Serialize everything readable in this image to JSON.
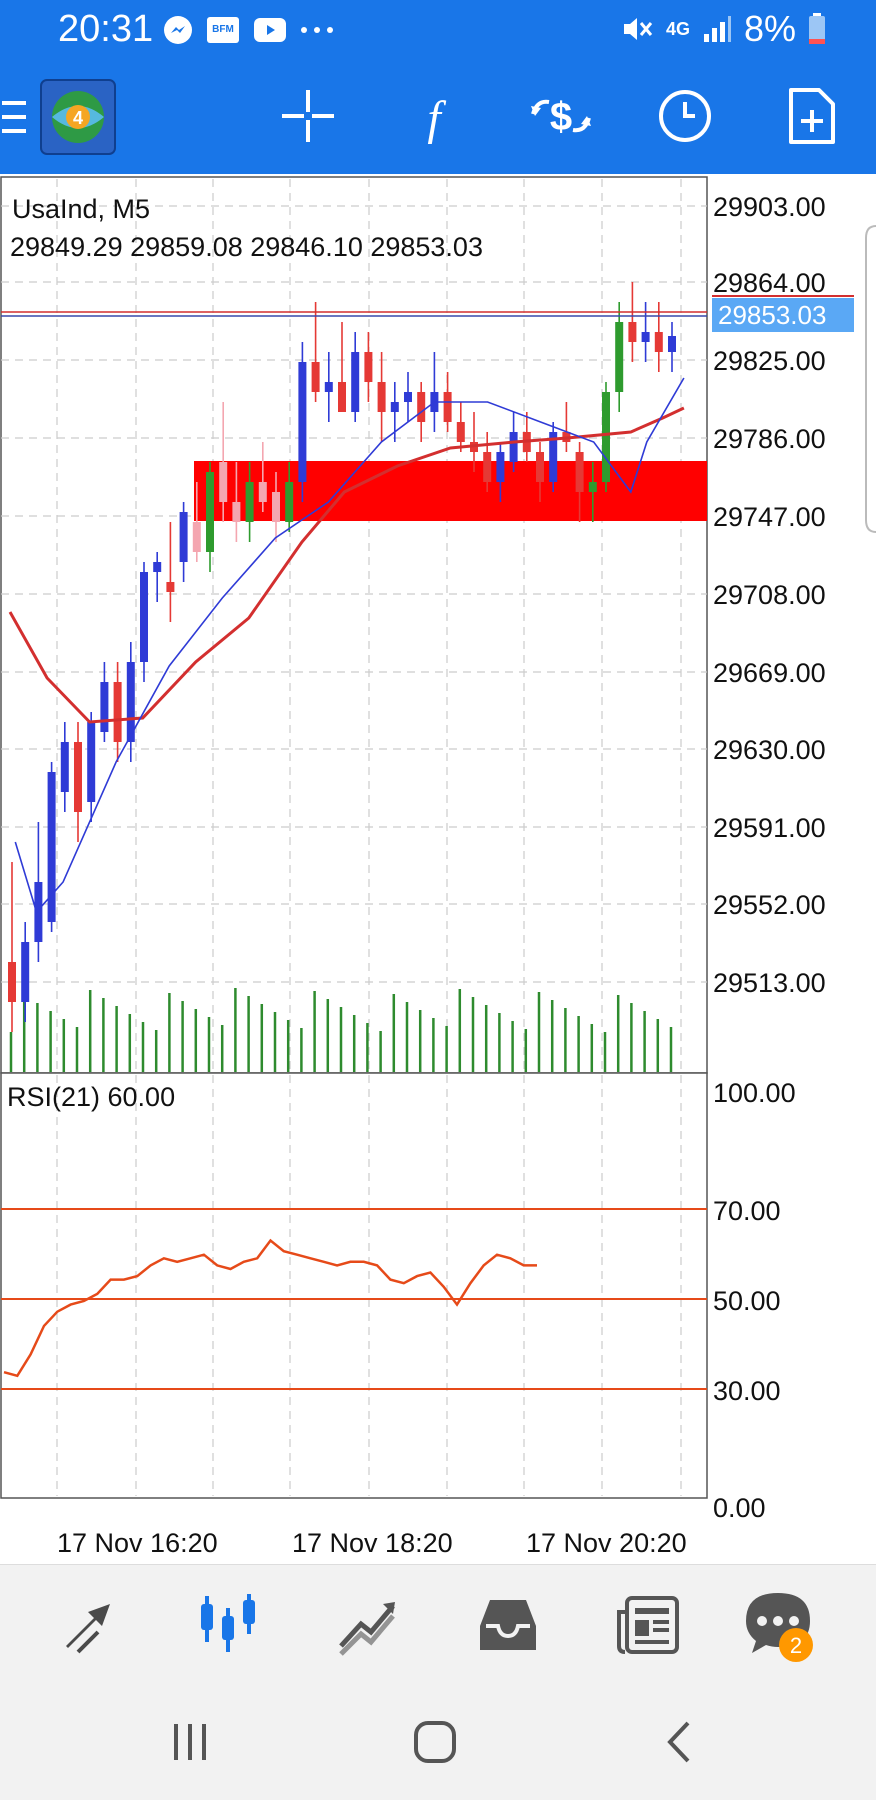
{
  "status_bar": {
    "time": "20:31",
    "network": "4G",
    "battery": "8%",
    "icons": [
      "messenger-icon",
      "bfm-business-icon",
      "youtube-icon",
      "more-dots-icon",
      "mute-icon",
      "signal-icon",
      "battery-icon"
    ]
  },
  "toolbar": {
    "buttons": [
      "crosshair",
      "indicators",
      "trade",
      "timeframe",
      "new-order"
    ]
  },
  "chart": {
    "symbol": "UsaInd, M5",
    "ohlc": "29849.29 29859.08 29846.10 29853.03",
    "current_price_tag": "29853.03",
    "price_labels": [
      "29903.00",
      "29864.00",
      "29825.00",
      "29786.00",
      "29747.00",
      "29708.00",
      "29669.00",
      "29630.00",
      "29591.00",
      "29552.00",
      "29513.00"
    ],
    "time_labels": [
      "17 Nov 16:20",
      "17 Nov 18:20",
      "17 Nov 20:20"
    ]
  },
  "rsi": {
    "title": "RSI(21) 60.00",
    "labels": [
      "100.00",
      "70.00",
      "50.00",
      "30.00",
      "0.00"
    ]
  },
  "bottom_tabs": {
    "items": [
      "quotes",
      "chart",
      "trade",
      "history",
      "news",
      "chat"
    ],
    "chat_badge": "2"
  },
  "colors": {
    "brand_blue": "#1976e8",
    "bull": "#2f3bd6",
    "bear": "#e53935",
    "zone_red": "#ff0000",
    "volume_green": "#2e8b2e",
    "rsi_line": "#e64a19"
  },
  "chart_data": {
    "type": "candlestick",
    "ylim": [
      29490,
      29930
    ],
    "ma_fast": [
      [
        1,
        29600
      ],
      [
        5,
        29565
      ],
      [
        10,
        29580
      ],
      [
        20,
        29640
      ],
      [
        30,
        29688
      ],
      [
        40,
        29722
      ],
      [
        50,
        29752
      ],
      [
        60,
        29770
      ],
      [
        70,
        29800
      ],
      [
        80,
        29820
      ],
      [
        90,
        29820
      ],
      [
        100,
        29810
      ],
      [
        110,
        29800
      ],
      [
        117,
        29775
      ],
      [
        120,
        29800
      ],
      [
        127,
        29832
      ]
    ],
    "ma_slow": [
      [
        0,
        29715
      ],
      [
        7,
        29682
      ],
      [
        15,
        29660
      ],
      [
        25,
        29662
      ],
      [
        35,
        29690
      ],
      [
        45,
        29712
      ],
      [
        55,
        29750
      ],
      [
        63,
        29775
      ],
      [
        73,
        29788
      ],
      [
        83,
        29797
      ],
      [
        95,
        29800
      ],
      [
        105,
        29802
      ],
      [
        117,
        29805
      ],
      [
        123,
        29812
      ],
      [
        127,
        29817
      ]
    ],
    "rsi_values": [
      30,
      29,
      35,
      43,
      47,
      49,
      50,
      52,
      56,
      56,
      57,
      60,
      62,
      61,
      62,
      63,
      60,
      59,
      61,
      62,
      67,
      64,
      63,
      62,
      61,
      60,
      61,
      61,
      60,
      56,
      55,
      57,
      58,
      54,
      49,
      55,
      60,
      63,
      62,
      60,
      60
    ]
  }
}
